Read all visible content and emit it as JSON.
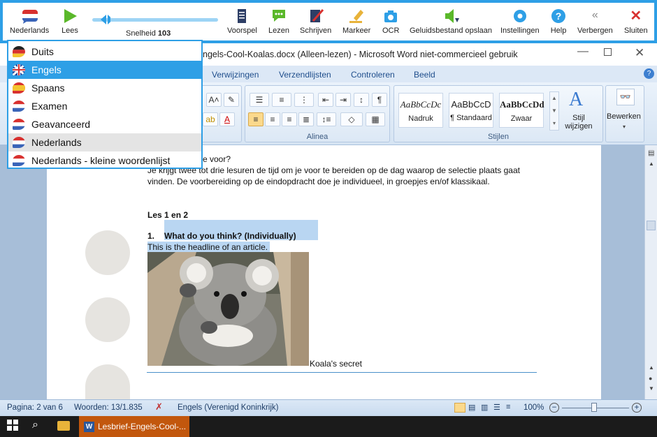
{
  "toolbar": {
    "language": "Nederlands",
    "read": "Lees",
    "speed_prefix": "Snelheid",
    "speed_value": "103",
    "speed_level": 0.1,
    "buttons": [
      "Voorspel",
      "Lezen",
      "Schrijven",
      "Markeer",
      "OCR",
      "Geluidsbestand opslaan",
      "Instellingen",
      "Help",
      "Verbergen",
      "Sluiten"
    ]
  },
  "language_menu": {
    "items": [
      "Duits",
      "Engels",
      "Spaans",
      "Examen",
      "Geavanceerd",
      "Nederlands",
      "Nederlands - kleine woordenlijst"
    ],
    "selected": "Engels",
    "hovered": "Nederlands"
  },
  "word": {
    "title": "ngels-Cool-Koalas.docx (Alleen-lezen) - Microsoft Word niet-commercieel gebruik",
    "tabs": [
      "Verwijzingen",
      "Verzendlijsten",
      "Controleren",
      "Beeld"
    ],
    "groups": {
      "paragraph": "Alinea",
      "styles": "Stijlen"
    },
    "styles": [
      {
        "sample": "AaBbCcDc",
        "name": "Nadruk"
      },
      {
        "sample": "AaBbCcD",
        "name": "¶ Standaard"
      },
      {
        "sample": "AaBbCcDd",
        "name": "Zwaar"
      }
    ],
    "change_styles": [
      "Stijl",
      "wijzigen"
    ],
    "edit": "Bewerken"
  },
  "document": {
    "line0": "e voor?",
    "line1": "Je krijgt twee tot drie lesuren de tijd om je voor te bereiden op de dag waarop de selectie plaats gaat",
    "line2": "vinden. De voorbereiding op de eindopdracht doe je individueel, in groepjes en/of klassikaal.",
    "heading": "Les 1 en 2",
    "item_number": "1.",
    "item_text": "What do you think? (Individually)",
    "highlighted": "This is the headline of an article.",
    "caption": "Koala's secret"
  },
  "status": {
    "page": "Pagina: 2 van 6",
    "words": "Woorden: 13/1.835",
    "language": "Engels (Verenigd Koninkrijk)",
    "zoom": "100%"
  },
  "taskbar": {
    "window": "Lesbrief-Engels-Cool-..."
  },
  "colors": {
    "accent": "#2e9fe6",
    "selection": "#2e9fe6",
    "highlight": "#b9d6f2"
  }
}
